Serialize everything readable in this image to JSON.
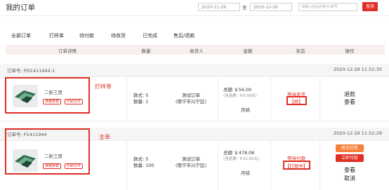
{
  "header": {
    "title": "我的订单",
    "date_start": "2020-11-29",
    "date_separator": "至",
    "date_end": "2020-12-29",
    "search_placeholder": "请输入商品名称/订单号",
    "search_button": "查询"
  },
  "tabs": [
    {
      "label": "全部订单"
    },
    {
      "label": "打样单"
    },
    {
      "label": "待付款"
    },
    {
      "label": "待收货"
    },
    {
      "label": "已完成"
    },
    {
      "label": "售后/退款"
    }
  ],
  "columns": [
    "订单详情",
    "数量",
    "收货人",
    "金额",
    "状态",
    "操作"
  ],
  "orders": [
    {
      "id_text": "订单号: PD1411944-1",
      "time": "2020-12-29 11:52:30",
      "type_label": "打样单",
      "product": {
        "name": "二折三页",
        "chip_params": "读稿参数",
        "chip_file": "印刷文件"
      },
      "qty_styles": "款式: 5",
      "qty_count": "数量: 1",
      "receiver_name": "测试订单",
      "receiver_area": "(南宁市兴宁区)",
      "amount_total": "总额 ￥56.00",
      "amount_shipping": "(含运费: ￥6.00元)",
      "payment": "月结",
      "status": "等待发货",
      "status_tag": "【样】",
      "actions": [
        "退款",
        "查看"
      ]
    },
    {
      "id_text": "订单号: P1411944",
      "time": "2020-12-29 11:52:29",
      "type_label": "主单",
      "product": {
        "name": "二折三页",
        "chip_params": "读稿参数",
        "chip_file": "印刷文件"
      },
      "qty_styles": "款式: 5",
      "qty_count": "数量: 100",
      "receiver_name": "测试订单",
      "receiver_area": "(南宁市兴宁区)",
      "amount_total": "总额 ￥478.08",
      "amount_shipping": "(含运费: ￥21.00元)",
      "payment": "月结",
      "status": "等待付款",
      "status_tag": "【打样中】",
      "buttons": [
        "再次打样",
        "立即付款"
      ],
      "actions": [
        "查看",
        "取消"
      ]
    }
  ],
  "colors": {
    "accent_red": "#e02e24",
    "orange": "#f7803a",
    "table_head_bg": "#f7efed"
  }
}
